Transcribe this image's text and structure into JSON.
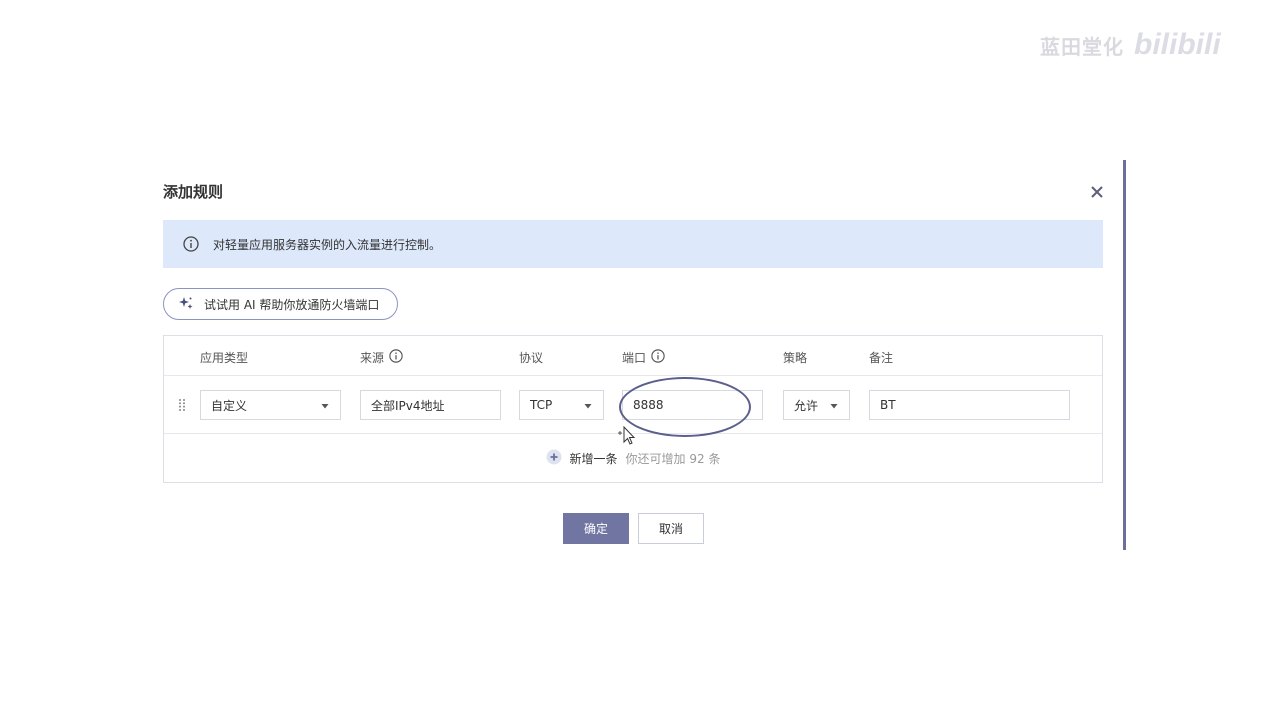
{
  "watermark": {
    "text": "蓝田堂化",
    "logo": "bilibili"
  },
  "dialog": {
    "title": "添加规则",
    "notice": "对轻量应用服务器实例的入流量进行控制。",
    "ai_button": "试试用 AI 帮助你放通防火墙端口",
    "headers": {
      "app_type": "应用类型",
      "source": "来源",
      "protocol": "协议",
      "port": "端口",
      "policy": "策略",
      "remark": "备注"
    },
    "row": {
      "app_type": "自定义",
      "source": "全部IPv4地址",
      "protocol": "TCP",
      "port": "8888",
      "policy": "允许",
      "remark": "BT"
    },
    "add_row": {
      "label": "新增一条",
      "hint": "你还可增加 92 条"
    },
    "confirm_label": "确定",
    "cancel_label": "取消"
  },
  "colors": {
    "accent": "#7075a1",
    "notice_bg": "#dde8fb",
    "border": "#dcdfe6"
  },
  "icons": [
    "close-icon",
    "info-icon",
    "sparkle-icon",
    "drag-handle-icon",
    "chevron-down-icon",
    "plus-circle-icon",
    "cursor-icon"
  ]
}
